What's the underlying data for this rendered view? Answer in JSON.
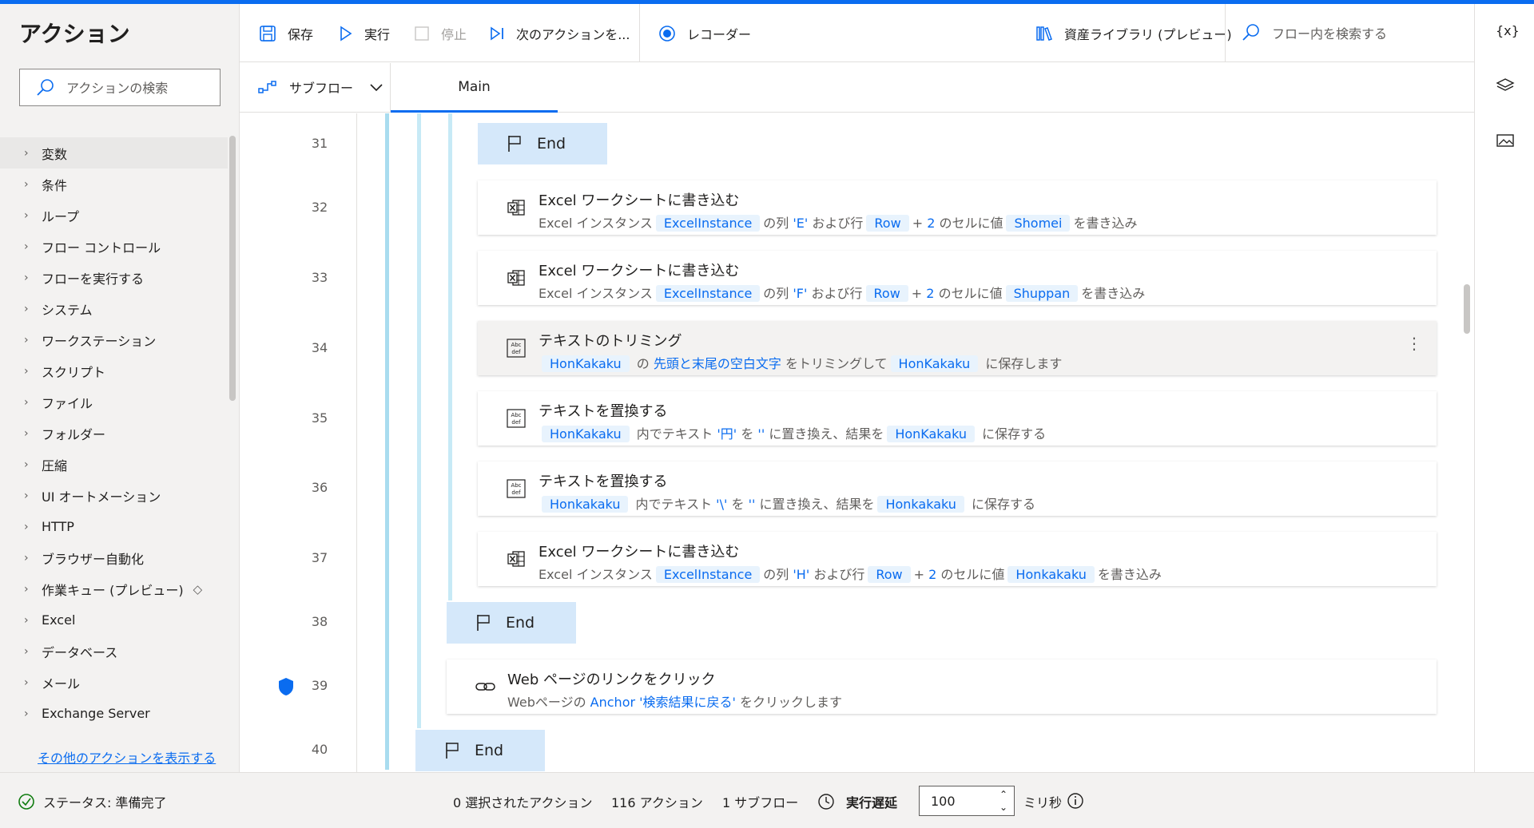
{
  "left_panel": {
    "title": "アクション",
    "search_placeholder": "アクションの検索",
    "categories": [
      {
        "label": "変数",
        "selected": true
      },
      {
        "label": "条件"
      },
      {
        "label": "ループ"
      },
      {
        "label": "フロー コントロール"
      },
      {
        "label": "フローを実行する"
      },
      {
        "label": "システム"
      },
      {
        "label": "ワークステーション"
      },
      {
        "label": "スクリプト"
      },
      {
        "label": "ファイル"
      },
      {
        "label": "フォルダー"
      },
      {
        "label": "圧縮"
      },
      {
        "label": "UI オートメーション"
      },
      {
        "label": "HTTP"
      },
      {
        "label": "ブラウザー自動化"
      },
      {
        "label": "作業キュー (プレビュー)",
        "icon": "premium-diamond-icon"
      },
      {
        "label": "Excel"
      },
      {
        "label": "データベース"
      },
      {
        "label": "メール"
      },
      {
        "label": "Exchange Server"
      }
    ],
    "more_link": "その他のアクションを表示する"
  },
  "toolbar": {
    "save": "保存",
    "run": "実行",
    "stop": "停止",
    "next_action": "次のアクションを...",
    "recorder": "レコーダー",
    "asset_library": "資産ライブラリ (プレビュー)",
    "flow_search": "フロー内を検索する"
  },
  "tabs": {
    "subflow": "サブフロー",
    "main": "Main"
  },
  "rail": {
    "variables": "{x}"
  },
  "editor": {
    "line_numbers": [
      "31",
      "32",
      "33",
      "34",
      "35",
      "36",
      "37",
      "38",
      "39",
      "40"
    ],
    "end_label": "End",
    "actions": {
      "l32": {
        "title": "Excel ワークシートに書き込む",
        "p1": "Excel インスタンス",
        "t1": "ExcelInstance",
        "p2": "の列",
        "lit1": "'E'",
        "p3": "および行",
        "t2": "Row",
        "p4": "+",
        "lit2": "2",
        "p5": "のセルに値",
        "t3": "Shomei",
        "p6": "を書き込み"
      },
      "l33": {
        "title": "Excel ワークシートに書き込む",
        "p1": "Excel インスタンス",
        "t1": "ExcelInstance",
        "p2": "の列",
        "lit1": "'F'",
        "p3": "および行",
        "t2": "Row",
        "p4": "+",
        "lit2": "2",
        "p5": "のセルに値",
        "t3": "Shuppan",
        "p6": "を書き込み"
      },
      "l34": {
        "title": "テキストのトリミング",
        "t1": "HonKakaku",
        "p1": "の",
        "lit1": "先頭と末尾の空白文字",
        "p2": "をトリミングして",
        "t2": "HonKakaku",
        "p3": "に保存します"
      },
      "l35": {
        "title": "テキストを置換する",
        "t1": "HonKakaku",
        "p1": "内でテキスト",
        "lit1": "'円'",
        "p2": "を",
        "lit2": "''",
        "p3": "に置き換え、結果を",
        "t2": "HonKakaku",
        "p4": "に保存する"
      },
      "l36": {
        "title": "テキストを置換する",
        "t1": "Honkakaku",
        "p1": "内でテキスト",
        "lit1": "'\\'",
        "p2": "を",
        "lit2": "''",
        "p3": "に置き換え、結果を",
        "t2": "Honkakaku",
        "p4": "に保存する"
      },
      "l37": {
        "title": "Excel ワークシートに書き込む",
        "p1": "Excel インスタンス",
        "t1": "ExcelInstance",
        "p2": "の列",
        "lit1": "'H'",
        "p3": "および行",
        "t2": "Row",
        "p4": "+",
        "lit2": "2",
        "p5": "のセルに値",
        "t3": "Honkakaku",
        "p6": "を書き込み"
      },
      "l39": {
        "title": "Web ページのリンクをクリック",
        "p1": "Webページの",
        "lit1": "Anchor '検索結果に戻る'",
        "p2": "をクリックします"
      }
    }
  },
  "status": {
    "status_text": "ステータス: 準備完了",
    "selected": "0 選択されたアクション",
    "actions": "116 アクション",
    "subflows": "1 サブフロー",
    "delay_label": "実行遅延",
    "delay_value": "100",
    "delay_unit": "ミリ秒"
  },
  "colors": {
    "accent": "#0a6cf0",
    "token_bg": "#e8f3fd",
    "end_block": "#d5e8fa",
    "nest_bar": "#c7eaf6"
  }
}
